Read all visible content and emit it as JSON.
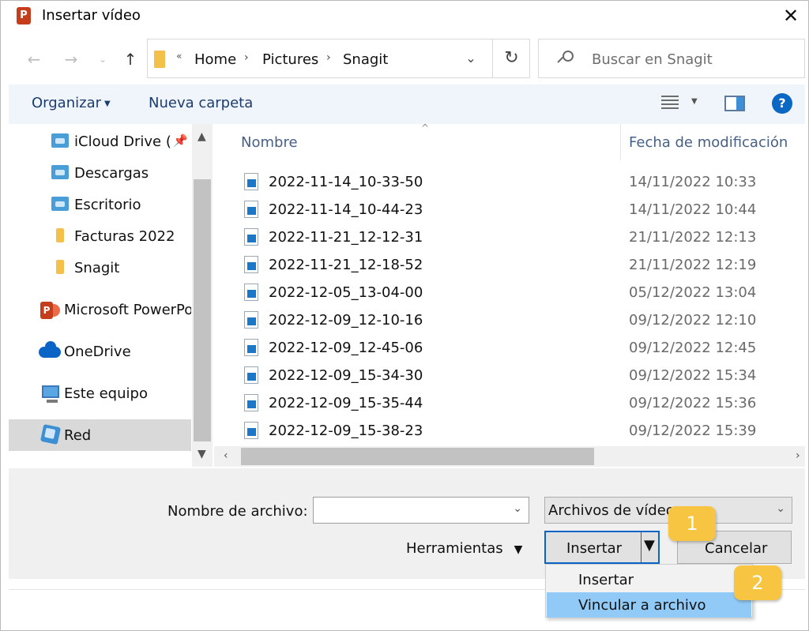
{
  "window": {
    "title": "Insertar vídeo"
  },
  "nav": {
    "breadcrumb": [
      "Home",
      "Pictures",
      "Snagit"
    ],
    "search_placeholder": "Buscar en Snagit"
  },
  "toolbar": {
    "organize_label": "Organizar",
    "new_folder_label": "Nueva carpeta"
  },
  "sidebar": {
    "items": [
      {
        "label": "iCloud Drive (",
        "icon": "folder-cloud-icon"
      },
      {
        "label": "Descargas",
        "icon": "downloads-folder-icon"
      },
      {
        "label": "Escritorio",
        "icon": "desktop-folder-icon"
      },
      {
        "label": "Facturas 2022",
        "icon": "folder-icon"
      },
      {
        "label": "Snagit",
        "icon": "folder-icon"
      },
      {
        "label": "Microsoft PowerPo",
        "icon": "powerpoint-icon"
      },
      {
        "label": "OneDrive",
        "icon": "onedrive-icon"
      },
      {
        "label": "Este equipo",
        "icon": "computer-icon"
      },
      {
        "label": "Red",
        "icon": "network-icon"
      }
    ]
  },
  "filelist": {
    "columns": [
      "Nombre",
      "Fecha de modificación"
    ],
    "rows": [
      {
        "name": "2022-11-14_10-33-50",
        "date": "14/11/2022 10:33"
      },
      {
        "name": "2022-11-14_10-44-23",
        "date": "14/11/2022 10:44"
      },
      {
        "name": "2022-11-21_12-12-31",
        "date": "21/11/2022 12:13"
      },
      {
        "name": "2022-11-21_12-18-52",
        "date": "21/11/2022 12:19"
      },
      {
        "name": "2022-12-05_13-04-00",
        "date": "05/12/2022 13:04"
      },
      {
        "name": "2022-12-09_12-10-16",
        "date": "09/12/2022 12:10"
      },
      {
        "name": "2022-12-09_12-45-06",
        "date": "09/12/2022 12:45"
      },
      {
        "name": "2022-12-09_15-34-30",
        "date": "09/12/2022 15:34"
      },
      {
        "name": "2022-12-09_15-35-44",
        "date": "09/12/2022 15:36"
      },
      {
        "name": "2022-12-09_15-38-23",
        "date": "09/12/2022 15:39"
      }
    ]
  },
  "bottom": {
    "filename_label": "Nombre de archivo:",
    "filename_value": "",
    "filetype_value": "Archivos de vídeo",
    "tools_label": "Herramientas",
    "insert_label": "Insertar",
    "cancel_label": "Cancelar"
  },
  "menu": {
    "items": [
      "Insertar",
      "Vincular a archivo"
    ]
  },
  "callouts": [
    "1",
    "2"
  ],
  "colors": {
    "accent": "#0a64c6",
    "callout": "#f7c542",
    "highlight": "#91c9f7",
    "toolbar_bg": "#f0f5fb"
  }
}
